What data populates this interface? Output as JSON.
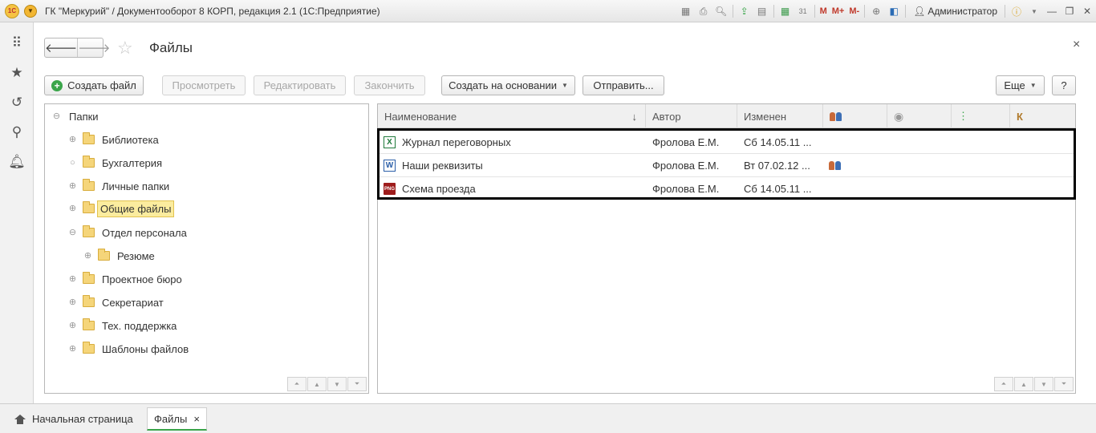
{
  "window": {
    "title": "ГК \"Меркурий\" / Документооборот 8 КОРП, редакция 2.1  (1С:Предприятие)",
    "logo_text": "1C",
    "user": "Администратор",
    "toolbar_m_labels": [
      "M",
      "M+",
      "M-"
    ],
    "calendar_day": "31"
  },
  "rail": {
    "icons": [
      "apps-grid-icon",
      "favorites-star-icon",
      "history-icon",
      "search-icon",
      "notifications-bell-icon"
    ]
  },
  "form": {
    "title": "Файлы",
    "back_glyph": "🡐",
    "forward_glyph": "🡒",
    "close_glyph": "×"
  },
  "command_bar": {
    "create_file": "Создать файл",
    "view": "Просмотреть",
    "edit": "Редактировать",
    "finish": "Закончить",
    "create_based_on": "Создать на основании",
    "send": "Отправить...",
    "more": "Еще",
    "help": "?"
  },
  "tree": {
    "root": "Папки",
    "items": [
      {
        "label": "Библиотека",
        "expander": "⊕"
      },
      {
        "label": "Бухгалтерия",
        "expander": "○"
      },
      {
        "label": "Личные папки",
        "expander": "⊕"
      },
      {
        "label": "Общие файлы",
        "expander": "⊕",
        "selected": true
      },
      {
        "label": "Отдел персонала",
        "expander": "⊖"
      },
      {
        "label": "Резюме",
        "expander": "⊕",
        "child": true
      },
      {
        "label": "Проектное бюро",
        "expander": "⊕"
      },
      {
        "label": "Секретариат",
        "expander": "⊕"
      },
      {
        "label": "Тех. поддержка",
        "expander": "⊕"
      },
      {
        "label": "Шаблоны файлов",
        "expander": "⊕"
      }
    ]
  },
  "grid": {
    "columns": {
      "name": "Наименование",
      "author": "Автор",
      "modified": "Изменен",
      "last": "К"
    },
    "sort_glyph": "↓",
    "rows": [
      {
        "icon": "excel-file-icon",
        "icon_text": "X",
        "name": "Журнал переговорных",
        "author": "Фролова Е.М.",
        "modified": "Сб 14.05.11 ...",
        "shared": false
      },
      {
        "icon": "word-file-icon",
        "icon_text": "W",
        "name": "Наши реквизиты",
        "author": "Фролова Е.М.",
        "modified": "Вт 07.02.12 ...",
        "shared": true
      },
      {
        "icon": "png-file-icon",
        "icon_text": "PNG",
        "name": "Схема проезда",
        "author": "Фролова Е.М.",
        "modified": "Сб 14.05.11 ...",
        "shared": false
      }
    ]
  },
  "tabs": {
    "home": "Начальная страница",
    "files": "Файлы",
    "close_glyph": "×"
  }
}
